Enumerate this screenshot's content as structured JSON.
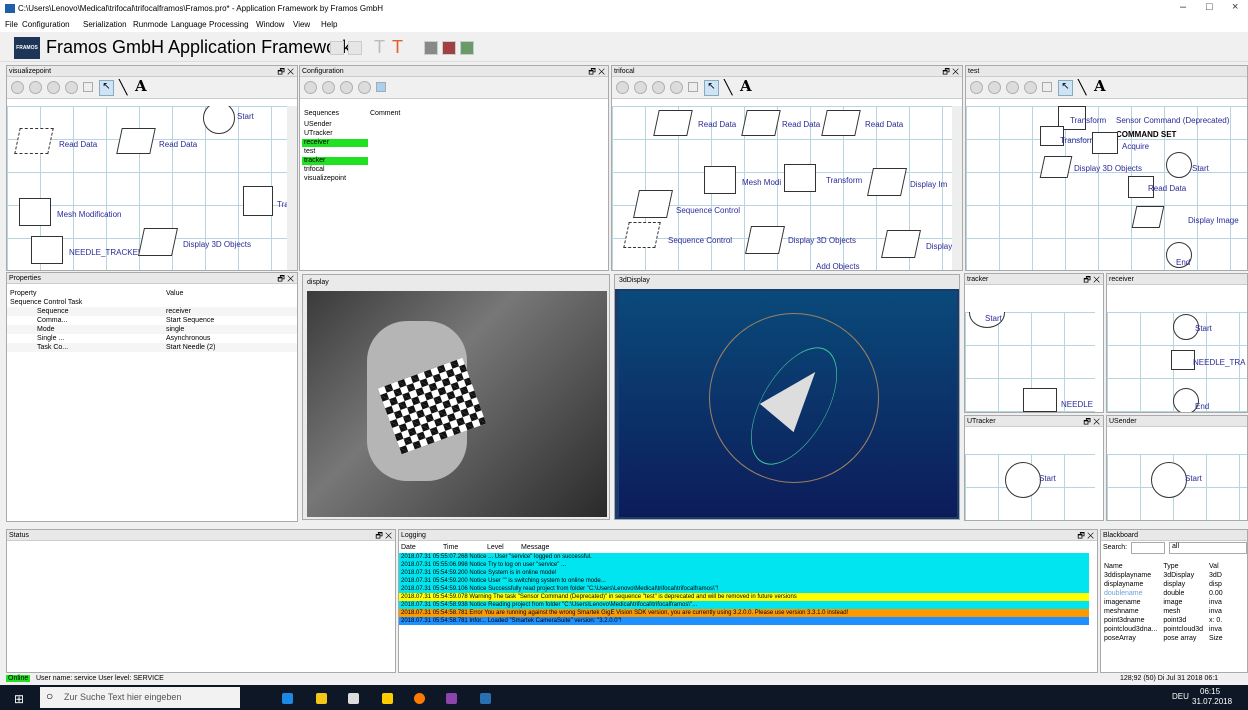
{
  "window": {
    "title": "C:\\Users\\Lenovo\\Medical\\trifocal\\trifocalframos\\Framos.pro* - Application Framework by Framos GmbH",
    "min": "–",
    "max": "□",
    "close": "×"
  },
  "menu": [
    "File",
    "Configuration",
    "Serialization",
    "Runmode",
    "Language",
    "Processing",
    "Window",
    "View",
    "Help"
  ],
  "app": {
    "logo": "FRAMOS",
    "title": "Framos GmbH  Application Framework"
  },
  "panes": {
    "visualizepoint": "visualizepoint",
    "configuration": "Configuration",
    "trifocal": "trifocal",
    "test": "test",
    "properties": "Properties",
    "display": "display",
    "display3d": "3dDisplay",
    "tracker": "tracker",
    "receiver": "receiver",
    "utracker": "UTracker",
    "usender": "USender",
    "status": "Status",
    "logging": "Logging",
    "blackboard": "Blackboard"
  },
  "text_tool": "A",
  "dock_controls": "🗗 ✕",
  "vp_nodes": [
    "Start",
    "Read Data",
    "Read Data",
    "Tra",
    "Mesh Modification",
    "NEEDLE_TRACKER",
    "Display 3D Objects"
  ],
  "config": {
    "col1": "Sequences",
    "col2": "Comment",
    "items": [
      "USender",
      "UTracker",
      "receiver",
      "test",
      "tracker",
      "trifocal",
      "visualizepoint"
    ],
    "highlight_color": "#22e022"
  },
  "trifocal_nodes": [
    "Read Data",
    "Read Data",
    "Read Data",
    "Mesh Modi",
    "Transform",
    "Display Im",
    "Sequence Control",
    "Sequence Control",
    "Display 3D Objects",
    "Display",
    "Add Objects"
  ],
  "test_nodes": [
    "Transform",
    "Sensor Command (Deprecated)",
    "Transform",
    "COMMAND SET",
    "Acquire",
    "Display 3D Objects",
    "Start",
    "Read Data",
    "Display Image",
    "End"
  ],
  "properties": {
    "h1": "Property",
    "h2": "Value",
    "group": "Sequence Control Task",
    "rows": [
      [
        "Sequence",
        "receiver"
      ],
      [
        "Comma...",
        "Start Sequence"
      ],
      [
        "Mode",
        "single"
      ],
      [
        "Single ...",
        "Asynchronous"
      ],
      [
        "Task Co...",
        "Start Needle (2)"
      ]
    ]
  },
  "tracker_nodes": [
    "Start",
    "NEEDLE"
  ],
  "receiver_nodes": [
    "Start",
    "NEEDLE_TRA",
    "End"
  ],
  "utracker_nodes": [
    "Start"
  ],
  "usender_nodes": [
    "Start"
  ],
  "logging": {
    "headers": [
      "Date",
      "Time",
      "Level",
      "Message"
    ],
    "rows": [
      [
        "2018.07.31",
        "05:55:07.268",
        "Notice",
        "... User \"service\" logged on successful.",
        "#00e5ef"
      ],
      [
        "2018.07.31",
        "05:55:06.998",
        "Notice",
        "Try to log on user \"service\" ...",
        "#00e5ef"
      ],
      [
        "2018.07.31",
        "05:54:59.200",
        "Notice",
        "System is in online mode!",
        "#00e5ef"
      ],
      [
        "2018.07.31",
        "05:54:59.200",
        "Notice",
        "User \"\" is switching system to online mode...",
        "#00e5ef"
      ],
      [
        "2018.07.31",
        "05:54:59.106",
        "Notice",
        "Successfully read project from folder \"C:\\Users\\Lenovo\\Medical\\trifocal\\trifocalframos\\\"!",
        "#00e5ef"
      ],
      [
        "2018.07.31",
        "05:54:59.078",
        "Warning",
        "The task \"Sensor Command (Deprecated)\" in sequence \"test\" is deprecated and will be removed in future versions",
        "#ffff00"
      ],
      [
        "2018.07.31",
        "05:54:58.938",
        "Notice",
        "Reading project from folder \"C:\\Users\\Lenovo\\Medical\\trifocal\\trifocalframos\\\"...",
        "#00e5ef"
      ],
      [
        "2018.07.31",
        "05:54:58.781",
        "Error",
        "You are running against the wrong Smartek GigE Vision SDK version, you are currently using 3.2.0.0. Please use version 3.3.1.0 instead!",
        "#ff9900"
      ],
      [
        "2018.07.31",
        "05:54:58.781",
        "Infor...",
        "Loaded \"Smartek CameraSuite\" version: \"3.2.0.0\"!",
        "#1e90ff"
      ]
    ]
  },
  "blackboard": {
    "search_label": "Search:",
    "search_value": "",
    "filter": "all",
    "headers": [
      "Name",
      "Type",
      "Val"
    ],
    "rows": [
      [
        "3ddisplayname",
        "3dDisplay",
        "3dD"
      ],
      [
        "displayname",
        "display",
        "disp"
      ],
      [
        "doublename",
        "double",
        "0.00"
      ],
      [
        "imagename",
        "image",
        "inva"
      ],
      [
        "meshname",
        "mesh",
        "inva"
      ],
      [
        "point3dname",
        "point3d",
        "x: 0."
      ],
      [
        "pointcloud3dna...",
        "pointcloud3d",
        "inva"
      ],
      [
        "poseArray",
        "pose array",
        "Size"
      ]
    ]
  },
  "statusbar": {
    "online": "Online",
    "user": "User name: service  User level: SERVICE",
    "coords": "128;92 (50)  Di Jul 31 2018  06:1"
  },
  "taskbar": {
    "search_placeholder": "Zur Suche Text hier eingeben",
    "lang": "DEU",
    "time": "06:15",
    "date": "31.07.2018"
  }
}
